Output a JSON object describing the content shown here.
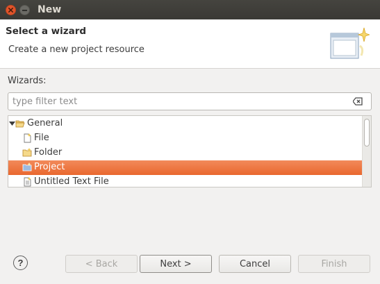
{
  "window": {
    "title": "New"
  },
  "header": {
    "title": "Select a wizard",
    "description": "Create a new project resource"
  },
  "wizards": {
    "label": "Wizards:",
    "filter_placeholder": "type filter text",
    "filter_value": ""
  },
  "tree": {
    "items": [
      {
        "label": "General",
        "icon": "folder-open-icon",
        "expanded": true,
        "level": 0
      },
      {
        "label": "File",
        "icon": "file-icon",
        "level": 1
      },
      {
        "label": "Folder",
        "icon": "folder-icon",
        "level": 1
      },
      {
        "label": "Project",
        "icon": "project-icon",
        "level": 1,
        "selected": true
      },
      {
        "label": "Untitled Text File",
        "icon": "text-file-icon",
        "level": 1
      }
    ]
  },
  "buttons": {
    "help": "?",
    "back": "< Back",
    "next": "Next >",
    "cancel": "Cancel",
    "finish": "Finish"
  },
  "colors": {
    "selection": "#e9682f",
    "titlebar": "#3c3b37",
    "close_button": "#e2542a"
  }
}
